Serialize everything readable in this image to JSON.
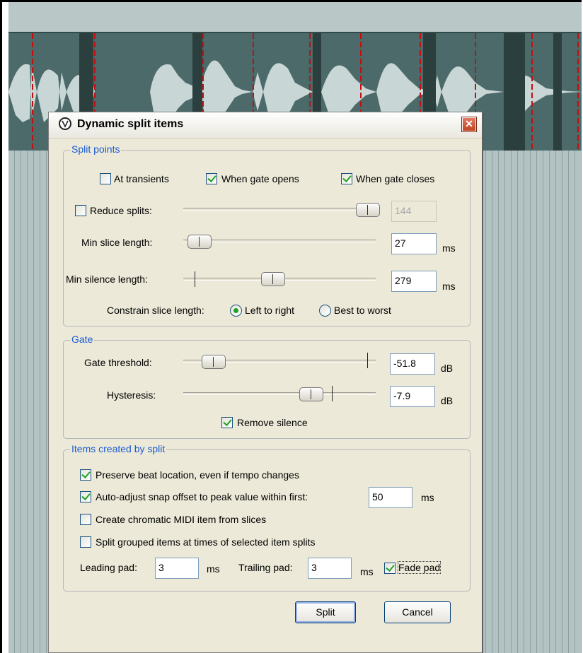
{
  "dialog": {
    "title": "Dynamic split items",
    "close_symbol": "✕"
  },
  "split_points": {
    "label": "Split points",
    "at_transients": {
      "label": "At transients",
      "checked": false
    },
    "when_gate_opens": {
      "label": "When gate opens",
      "checked": true
    },
    "when_gate_closes": {
      "label": "When gate closes",
      "checked": true
    },
    "reduce_splits": {
      "label": "Reduce splits:",
      "checked": false,
      "value": "144",
      "slider_fraction": 0.95
    },
    "min_slice_length": {
      "label": "Min slice length:",
      "value": "27",
      "unit": "ms",
      "slider_fraction": 0.05
    },
    "min_silence_length": {
      "label": "Min silence length:",
      "value": "279",
      "unit": "ms",
      "slider_fraction": 0.44
    },
    "constrain": {
      "label": "Constrain slice length:",
      "options": [
        "Left to right",
        "Best to worst"
      ],
      "selected": "Left to right"
    }
  },
  "gate": {
    "label": "Gate",
    "threshold": {
      "label": "Gate threshold:",
      "value": "-51.8",
      "unit": "dB",
      "slider_fraction": 0.15
    },
    "hysteresis": {
      "label": "Hysteresis:",
      "value": "-7.9",
      "unit": "dB",
      "slider_fraction": 0.64
    },
    "remove_silence": {
      "label": "Remove silence",
      "checked": true
    }
  },
  "items_created": {
    "label": "Items created by split",
    "preserve_beat": {
      "label": "Preserve beat location, even if tempo changes",
      "checked": true
    },
    "auto_adjust": {
      "label": "Auto-adjust snap offset to peak value within first:",
      "checked": true,
      "value": "50",
      "unit": "ms"
    },
    "chromatic_midi": {
      "label": "Create chromatic MIDI item from slices",
      "checked": false
    },
    "split_grouped": {
      "label": "Split grouped items at times of selected item splits",
      "checked": false
    },
    "leading_pad": {
      "label": "Leading pad:",
      "value": "3",
      "unit": "ms"
    },
    "trailing_pad": {
      "label": "Trailing pad:",
      "value": "3",
      "unit": "ms"
    },
    "fade_pad": {
      "label": "Fade pad",
      "checked": true
    }
  },
  "buttons": {
    "split": "Split",
    "cancel": "Cancel"
  },
  "colors": {
    "group_label": "#1a5bd0",
    "check_mark": "#21a121",
    "dialog_bg": "#ece9d8",
    "waveform": "#c8d6d5",
    "item_bg": "#4b6a69"
  },
  "icons": [
    "split-icon",
    "close-icon",
    "check-icon"
  ]
}
